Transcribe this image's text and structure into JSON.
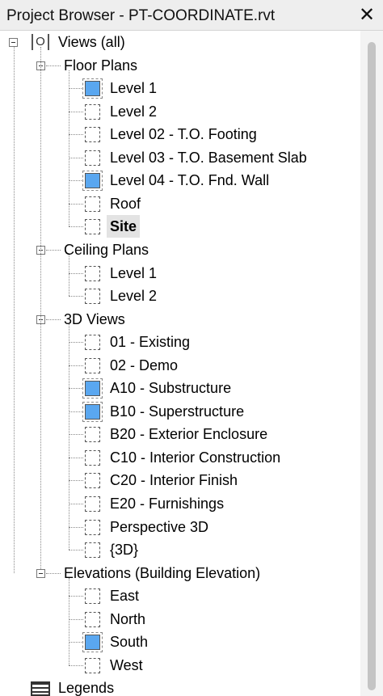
{
  "window": {
    "title": "Project Browser - PT-COORDINATE.rvt",
    "close_glyph": "✕",
    "close_icon": "close-icon"
  },
  "tree": {
    "root": {
      "label": "Views (all)",
      "icon": "views-icon",
      "expanded": true
    },
    "floor_plans": {
      "label": "Floor Plans",
      "expanded": true,
      "items": [
        {
          "label": "Level 1",
          "open": true
        },
        {
          "label": "Level 2",
          "open": false
        },
        {
          "label": "Level 02 - T.O. Footing",
          "open": false
        },
        {
          "label": "Level 03 - T.O. Basement Slab",
          "open": false
        },
        {
          "label": "Level 04 - T.O. Fnd. Wall",
          "open": true
        },
        {
          "label": "Roof",
          "open": false
        },
        {
          "label": "Site",
          "open": false,
          "selected": true
        }
      ]
    },
    "ceiling_plans": {
      "label": "Ceiling Plans",
      "expanded": true,
      "items": [
        {
          "label": "Level 1",
          "open": false
        },
        {
          "label": "Level 2",
          "open": false
        }
      ]
    },
    "views_3d": {
      "label": "3D Views",
      "expanded": true,
      "items": [
        {
          "label": "01 - Existing",
          "open": false
        },
        {
          "label": "02 - Demo",
          "open": false
        },
        {
          "label": "A10 - Substructure",
          "open": true
        },
        {
          "label": "B10 - Superstructure",
          "open": true
        },
        {
          "label": "B20 - Exterior Enclosure",
          "open": false
        },
        {
          "label": "C10 - Interior Construction",
          "open": false
        },
        {
          "label": "C20 - Interior Finish",
          "open": false
        },
        {
          "label": "E20 - Furnishings",
          "open": false
        },
        {
          "label": "Perspective 3D",
          "open": false
        },
        {
          "label": "{3D}",
          "open": false
        }
      ]
    },
    "elevations": {
      "label": "Elevations (Building Elevation)",
      "expanded": true,
      "items": [
        {
          "label": "East",
          "open": false
        },
        {
          "label": "North",
          "open": false
        },
        {
          "label": "South",
          "open": true
        },
        {
          "label": "West",
          "open": false
        }
      ]
    },
    "legends": {
      "label": "Legends",
      "icon": "legend-icon"
    }
  },
  "colors": {
    "open_view": "#5aa7f0",
    "selection": "#e3e3e3",
    "titlebar": "#eeeeee"
  }
}
